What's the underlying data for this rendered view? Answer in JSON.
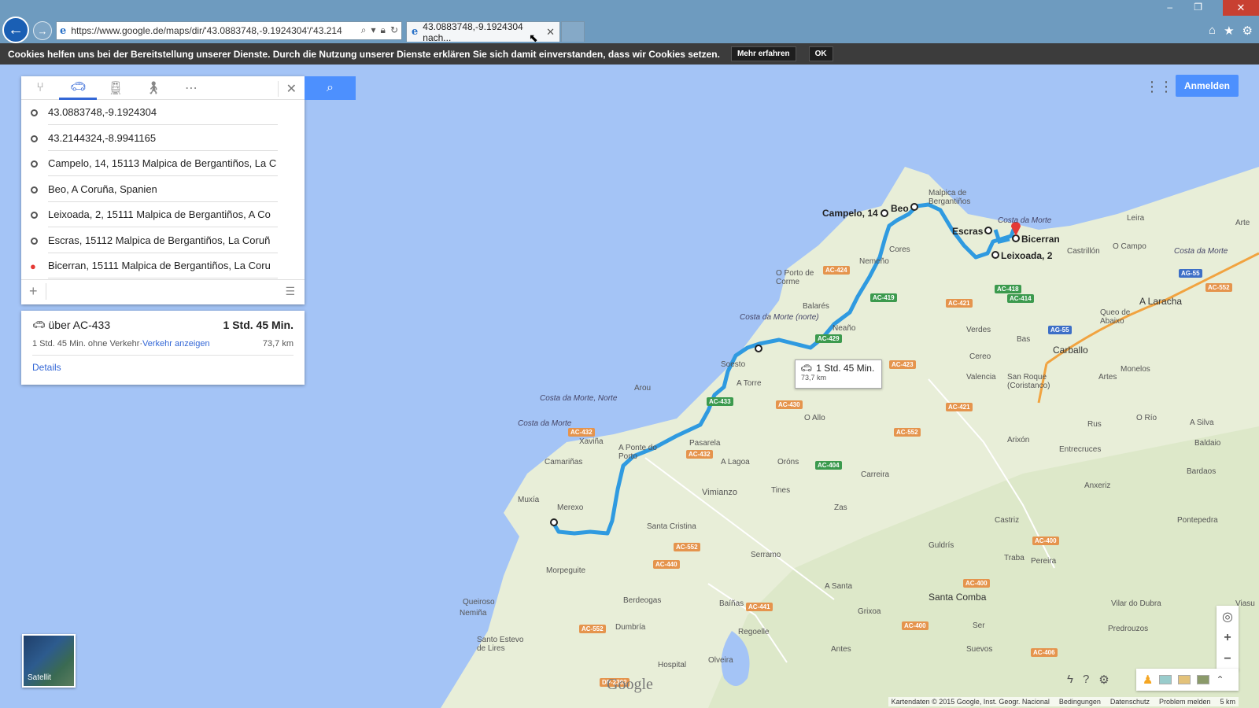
{
  "browser": {
    "url": "https://www.google.de/maps/dir/'43.0883748,-9.1924304'/'43.214",
    "tab_title": "43.0883748,-9.1924304 nach...",
    "tab_close": "✕",
    "win_min": "–",
    "win_max": "❐",
    "win_close": "✕"
  },
  "cookie": {
    "text": "Cookies helfen uns bei der Bereitstellung unserer Dienste. Durch die Nutzung unserer Dienste erklären Sie sich damit einverstanden, dass wir Cookies setzen.",
    "more": "Mehr erfahren",
    "ok": "OK"
  },
  "directions": {
    "waypoints": [
      "43.0883748,-9.1924304",
      "43.2144324,-8.9941165",
      "Campelo, 14, 15113 Malpica de Bergantiños, La C",
      "Beo, A Coruña, Spanien",
      "Leixoada, 2, 15111 Malpica de Bergantiños, A Co",
      "Escras, 15112 Malpica de Bergantiños, La Coruñ",
      "Bicerran, 15111 Malpica de Bergantiños, La Coru"
    ],
    "add": "+"
  },
  "route": {
    "via": "über AC-433",
    "time": "1 Std. 45 Min.",
    "no_traffic": "1 Std. 45 Min. ohne Verkehr",
    "sep": " · ",
    "traffic_link": "Verkehr anzeigen",
    "distance": "73,7 km",
    "details": "Details"
  },
  "map": {
    "signin": "Anmelden",
    "bubble_time": "1 Std. 45 Min.",
    "bubble_km": "73,7 km",
    "satellite": "Satellit",
    "google": "Google",
    "labels": {
      "campelo": "Campelo, 14",
      "beo": "Beo",
      "malpica": "Malpica de Bergantiños",
      "escras": "Escras",
      "bicerran": "Bicerran",
      "leixoada": "Leixoada, 2",
      "costa_morte1": "Costa da Morte",
      "costa_morte2": "Costa da Morte",
      "costa_norte": "Costa da Morte (norte)",
      "costa_norte2": "Costa da Morte, Norte",
      "costa_morte3": "Costa da Morte",
      "a_laracha": "A Laracha",
      "carballo": "Carballo",
      "leira": "Leira",
      "o_campo": "O Campo",
      "castrillon": "Castrillón",
      "o_porto": "O Porto de Corme",
      "nemeno": "Nemeño",
      "cores": "Cores",
      "balares": "Balarés",
      "neaño": "Neaño",
      "verdes": "Verdes",
      "bas": "Bas",
      "cereo": "Cereo",
      "valencia": "Valencia",
      "san_roque": "San Roque (Coristanco)",
      "monelos": "Monelos",
      "artes": "Artes",
      "soesto": "Soesto",
      "atorre": "A Torre",
      "arou": "Arou",
      "xavina": "Xaviña",
      "camarinas": "Camariñas",
      "aporto": "A Ponte do Porto",
      "pasarela": "Pasarela",
      "alagoa": "A Lagoa",
      "oallo": "O Allo",
      "orons": "Oróns",
      "carreira": "Carreira",
      "zas": "Zas",
      "tines": "Tines",
      "vimianzo": "Vimianzo",
      "muxia": "Muxía",
      "merexo": "Merexo",
      "santa_cristina": "Santa Cristina",
      "morpeguite": "Morpeguite",
      "serramo": "Serramo",
      "asanta": "A Santa",
      "berdeogas": "Berdeogas",
      "bainas": "Baíñas",
      "dumbria": "Dumbría",
      "regoelle": "Regoelle",
      "olveira": "Olveira",
      "hospital": "Hospital",
      "antes": "Antes",
      "grixoa": "Grixoa",
      "santa_comba": "Santa Comba",
      "gulдris": "Guldrís",
      "ser": "Ser",
      "suevos": "Suevos",
      "quetroso": "Queiroso",
      "nemina": "Nemiña",
      "santo_estevo": "Santo Estevo de Lires",
      "rus": "Rus",
      "arixon": "Arixón",
      "entrecruces": "Entrecruces",
      "anxeriz": "Anxeriz",
      "castriz": "Castriz",
      "traba": "Traba",
      "pereira": "Pereira",
      "oriO": "O Río",
      "asilva": "A Silva",
      "baldaio": "Baldaio",
      "bardaos": "Bardaos",
      "pontepedra": "Pontepedra",
      "vilar": "Vilar do Dubra",
      "predrouzos": "Predrouzos",
      "quedo": "Queo de Abaixo",
      "artes2": "Arte",
      "viasuso": "Viasu"
    },
    "roads": [
      "AC-424",
      "AC-419",
      "AC-429",
      "AC-433",
      "AC-430",
      "AC-423",
      "AC-552",
      "AC-421",
      "AC-421",
      "AC-418",
      "AC-414",
      "AC-432",
      "AC-432",
      "AC-404",
      "AC-552",
      "AC-440",
      "AC-441",
      "AC-552",
      "AC-400",
      "AC-400",
      "AC-400",
      "AC-406",
      "DP-2302",
      "AG-55",
      "AG-55",
      "AC-552"
    ],
    "attribution": [
      "Kartendaten © 2015 Google, Inst. Geogr. Nacional",
      "Bedingungen",
      "Datenschutz",
      "Problem melden",
      "5 km"
    ]
  }
}
